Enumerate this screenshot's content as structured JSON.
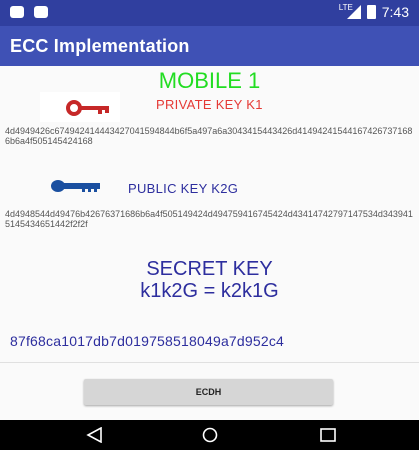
{
  "status_bar": {
    "time": "7:43",
    "network": "LTE"
  },
  "app_bar": {
    "title": "ECC Implementation"
  },
  "main": {
    "mobile_title": "MOBILE 1",
    "private_key": {
      "label": "PRIVATE KEY K1",
      "value": "4d4949426c674942414443427041594844b6f5a497a6a3043415443426d414942415441674267371686b6a4f505145424168"
    },
    "public_key": {
      "label": "PUBLIC KEY K2G",
      "value": "4d4948544d49476b42676371686b6a4f505149424d494759416745424d43414742797147534d3439415145434651442f2f2f"
    },
    "secret": {
      "title_line1": "SECRET KEY",
      "title_line2": "k1k2G = k2k1G",
      "value": "87f68ca1017db7d019758518049a7d952c4"
    },
    "ecdh_button": "ECDH"
  },
  "colors": {
    "status_bar": "#303f9f",
    "app_bar": "#3f51b5",
    "mobile_title": "#22dd22",
    "private_label": "#e53935",
    "blue_text": "#2d2e9e"
  },
  "icons": [
    "red-key-icon",
    "blue-key-icon",
    "back-icon",
    "home-icon",
    "recents-icon"
  ]
}
